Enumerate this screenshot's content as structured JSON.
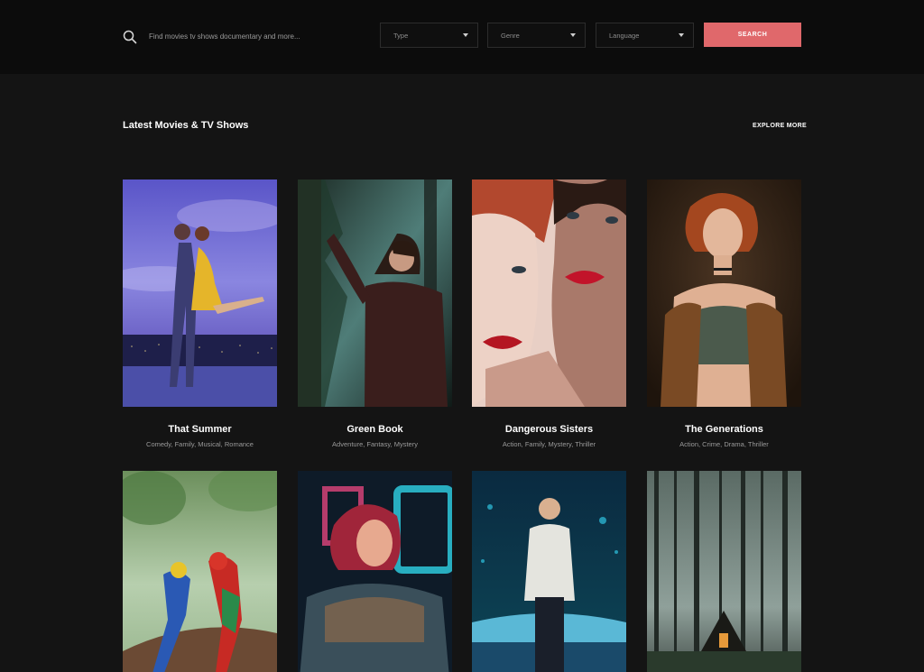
{
  "header": {
    "search": {
      "icon": "search-icon",
      "placeholder": "Find movies tv shows documentary and more..."
    },
    "filters": {
      "type_label": "Type",
      "genre_label": "Genre",
      "language_label": "Language"
    },
    "search_button_label": "SEARCH",
    "accent_color": "#e0686b"
  },
  "section": {
    "title": "Latest Movies & TV Shows",
    "explore_more_label": "EXPLORE MORE"
  },
  "movies": [
    {
      "title": "That Summer",
      "genres": "Comedy, Family, Musical, Romance"
    },
    {
      "title": "Green Book",
      "genres": "Adventure, Fantasy, Mystery"
    },
    {
      "title": "Dangerous Sisters",
      "genres": "Action, Family, Mystery, Thriller"
    },
    {
      "title": "The Generations",
      "genres": "Action, Crime, Drama, Thriller"
    },
    {
      "title": "",
      "genres": ""
    },
    {
      "title": "",
      "genres": ""
    },
    {
      "title": "",
      "genres": ""
    },
    {
      "title": "",
      "genres": ""
    }
  ]
}
